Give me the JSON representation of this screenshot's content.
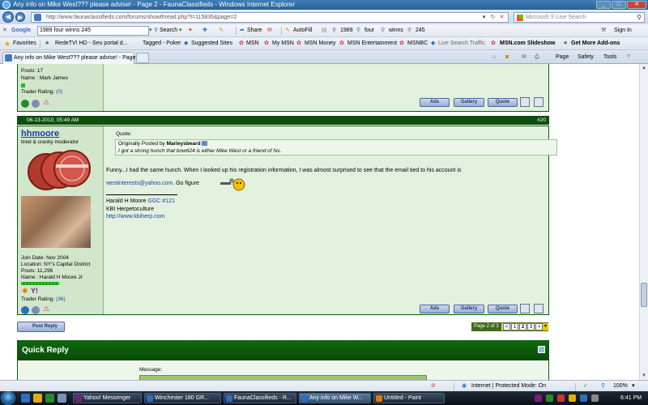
{
  "window": {
    "title": "Any info on Mike West??? please advise! - Page 2 - FaunaClassifieds - Windows Internet Explorer"
  },
  "address": {
    "url": "http://www.faunaclassifieds.com/forums/showthread.php?t=115835&page=2"
  },
  "search_box": {
    "placeholder": "Microsoft ® Live Search"
  },
  "google_bar": {
    "logo": "Google",
    "query": "1989 four winns 245",
    "items": [
      "Search",
      "Share",
      "AutoFill",
      "1989",
      "four",
      "winns",
      "245"
    ],
    "signin": "Sign In"
  },
  "favorites_bar": {
    "favorites_label": "Favorites",
    "links": [
      "RedeTV! HD - Seu portal d...",
      "Tagged - Poker",
      "Suggested Sites",
      "MSN",
      "My MSN",
      "MSN Money",
      "MSN Entertainment",
      "MSNBC",
      "Live Search Traffic",
      "MSN.com Slideshow",
      "Get More Add-ons"
    ]
  },
  "tabs": {
    "active": "Any info on Mike West??? please advise! - Page 2 ...",
    "commands": [
      "Page",
      "Safety",
      "Tools"
    ]
  },
  "prev_post": {
    "posts": "Posts: 17",
    "name": "Name : Mark James",
    "trader": "Trader Rating:",
    "trader_value": "(0)"
  },
  "post": {
    "date": "06-13-2010, 05:49 AM",
    "number": "#20",
    "username": "hhmoore",
    "user_title": "tired & cranky moderator",
    "join_date": "Join Date: Nov 2004",
    "location": "Location: NY's Capital District",
    "posts": "Posts: 11,296",
    "name": "Name : Harald H Moore Jr",
    "trader": "Trader Rating:",
    "trader_value": "(36)",
    "quote_label": "Quote:",
    "quote_prefix": "Originally Posted by",
    "quote_author": "Marleysbeard",
    "quote_text": "I got a strong hunch that bow624 is either Mike West or a friend of his.",
    "body": "Funny...I had the same hunch. When I looked up his registration information, I was almost surprised to see that the email tied to his account is",
    "email": "westinterests@yahoo.com",
    "after_email": ". Go figure",
    "sig_name": "Harald H Moore",
    "sig_link": "GGC #121",
    "sig_line2": "KBI Herpetoculture",
    "sig_url": "http://www.kbiherp.com"
  },
  "buttons": {
    "ads": "Ads",
    "gallery": "Gallery",
    "quote": "Quote"
  },
  "post_reply": "Post Reply",
  "pager": {
    "label": "Page 2 of 3",
    "pages": [
      "<",
      "1",
      "2",
      "3",
      ">"
    ]
  },
  "quick_reply": {
    "title": "Quick Reply",
    "message_label": "Message:"
  },
  "status": {
    "zone": "Internet | Protected Mode: On",
    "zoom": "100%"
  },
  "taskbar": {
    "items": [
      "Yahoo! Messenger",
      "Winchester 180 GR...",
      "FaunaClassifieds - R...",
      "Any info on Mike W...",
      "Untitled - Paint"
    ],
    "clock": "6:41 PM"
  },
  "colors": {
    "forum_green": "#0d4f0d",
    "post_bg": "#e2f1de",
    "link_blue": "#1a3fa3"
  }
}
